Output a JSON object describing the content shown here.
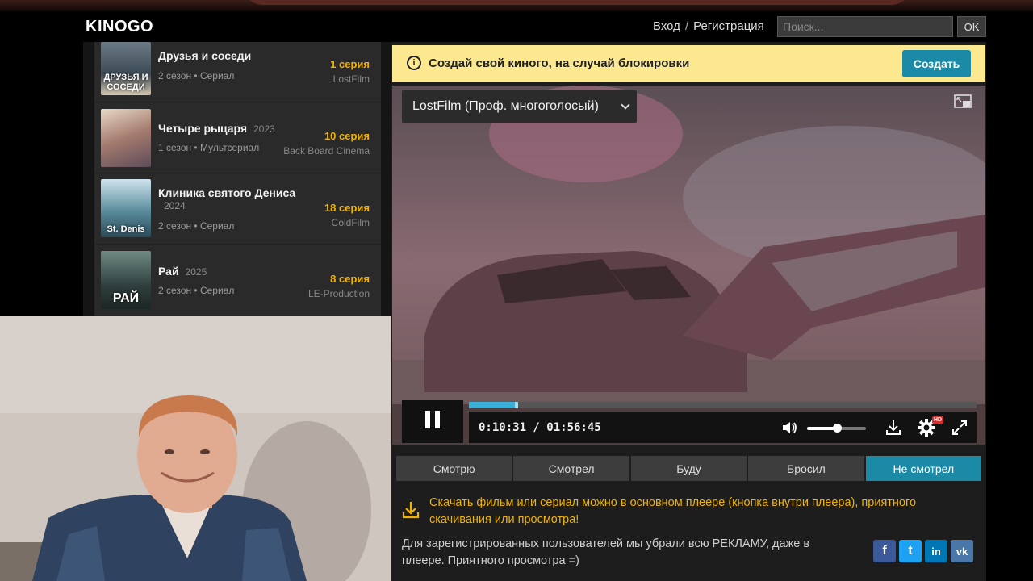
{
  "header": {
    "logo": "KINOGO",
    "login": "Вход",
    "separator": "/",
    "register": "Регистрация",
    "search_placeholder": "Поиск...",
    "ok_label": "OK"
  },
  "series_list": [
    {
      "title": "Друзья и соседи",
      "year": "",
      "meta": "2 сезон • Сериал",
      "episode": "1 серия",
      "studio": "LostFilm",
      "thumb_text": "ДРУЗЬЯ И СОСЕДИ"
    },
    {
      "title": "Четыре рыцаря",
      "year": "2023",
      "meta": "1 сезон • Мультсериал",
      "episode": "10 серия",
      "studio": "Back Board Cinema",
      "thumb_text": ""
    },
    {
      "title": "Клиника святого Дениса",
      "year": "2024",
      "meta": "2 сезон • Сериал",
      "episode": "18 серия",
      "studio": "ColdFilm",
      "thumb_text": "St. Denis"
    },
    {
      "title": "Рай",
      "year": "2025",
      "meta": "2 сезон • Сериал",
      "episode": "8 серия",
      "studio": "LE-Production",
      "thumb_text": "РАЙ"
    }
  ],
  "notice": {
    "text": "Создай свой киного, на случай блокировки",
    "button": "Создать"
  },
  "player": {
    "voice_track": "LostFilm (Проф. многоголосый)",
    "current_time": "0:10:31",
    "total_time": "01:56:45",
    "time_display": "0:10:31 / 01:56:45",
    "progress_fraction": 0.09,
    "volume_fraction": 0.5,
    "hd_badge": "HD"
  },
  "tabs": [
    "Смотрю",
    "Смотрел",
    "Буду",
    "Бросил",
    "Не смотрел"
  ],
  "active_tab": "Не смотрел",
  "download_note": "Скачать фильм или сериал можно в основном плеере (кнопка внутри плеера), приятного скачивания или просмотра!",
  "registered_note": "Для зарегистрированных пользователей мы убрали всю РЕКЛАМУ, даже в плеере. Приятного просмотра =)",
  "social": [
    {
      "name": "facebook",
      "glyph": "f",
      "color": "#3b5998"
    },
    {
      "name": "twitter",
      "glyph": "t",
      "color": "#1da1f2"
    },
    {
      "name": "linkedin",
      "glyph": "in",
      "color": "#0077b5"
    },
    {
      "name": "vk",
      "glyph": "vk",
      "color": "#4a76a8"
    }
  ],
  "colors": {
    "accent": "#1a8aa6",
    "episode": "#f0b400",
    "notice_bg": "#fbe88f"
  }
}
